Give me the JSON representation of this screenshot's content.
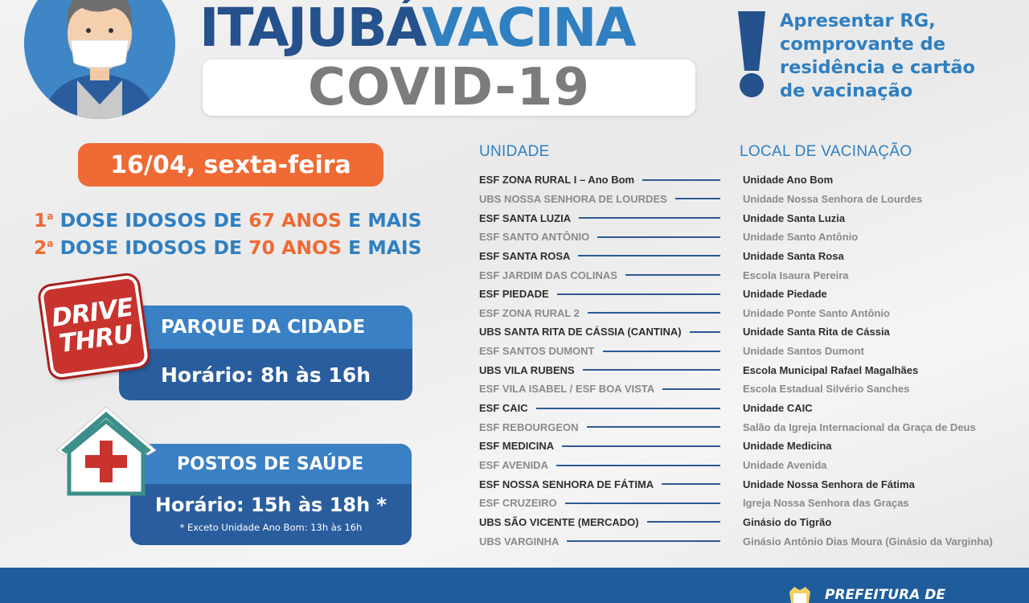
{
  "header": {
    "title_part1": "ITAJUBÁ",
    "title_part2": "VACINA",
    "subtitle": "COVID-19",
    "notice": "Apresentar RG,\ncomprovante de\nresidência e cartão\nde vacinação"
  },
  "schedule": {
    "date": "16/04, sexta-feira",
    "dose1": {
      "ord": "1",
      "sup": "a",
      "pre": "DOSE IDOSOS DE ",
      "age": "67 ANOS",
      "post": " E MAIS"
    },
    "dose2": {
      "ord": "2",
      "sup": "a",
      "pre": "DOSE IDOSOS DE ",
      "age": "70 ANOS",
      "post": " E MAIS"
    }
  },
  "drive_thru": {
    "sign_line1": "DRIVE",
    "sign_line2": "THRU",
    "location": "PARQUE DA CIDADE",
    "hours": "Horário: 8h às 16h"
  },
  "postos": {
    "location": "POSTOS DE SAÚDE",
    "hours": "Horário: 15h às 18h *",
    "note": "* Exceto Unidade Ano Bom: 13h às 16h"
  },
  "table": {
    "col_unit": "UNIDADE",
    "col_local": "LOCAL DE VACINAÇÃO",
    "rows": [
      {
        "unit": "ESF ZONA RURAL I – Ano Bom",
        "local": "Unidade Ano Bom"
      },
      {
        "unit": "UBS NOSSA SENHORA DE LOURDES",
        "local": "Unidade Nossa Senhora de Lourdes"
      },
      {
        "unit": "ESF SANTA LUZIA",
        "local": "Unidade Santa Luzia"
      },
      {
        "unit": "ESF SANTO ANTÔNIO",
        "local": "Unidade Santo Antônio"
      },
      {
        "unit": "ESF SANTA ROSA",
        "local": "Unidade Santa Rosa"
      },
      {
        "unit": "ESF JARDIM DAS COLINAS",
        "local": "Escola Isaura Pereira"
      },
      {
        "unit": "ESF PIEDADE",
        "local": "Unidade Piedade"
      },
      {
        "unit": "ESF ZONA RURAL 2",
        "local": "Unidade Ponte Santo Antônio"
      },
      {
        "unit": "UBS SANTA RITA DE CÁSSIA (CANTINA)",
        "local": "Unidade Santa Rita de Cássia"
      },
      {
        "unit": "ESF SANTOS DUMONT",
        "local": "Unidade Santos Dumont"
      },
      {
        "unit": "UBS VILA RUBENS",
        "local": "Escola Municipal Rafael Magalhães"
      },
      {
        "unit": "ESF VILA ISABEL / ESF BOA VISTA",
        "local": "Escola Estadual Silvério Sanches"
      },
      {
        "unit": "ESF CAIC",
        "local": "Unidade CAIC"
      },
      {
        "unit": "ESF REBOURGEON",
        "local": "Salão da Igreja Internacional da Graça de Deus"
      },
      {
        "unit": "ESF MEDICINA",
        "local": "Unidade Medicina"
      },
      {
        "unit": "ESF AVENIDA",
        "local": "Unidade Avenida"
      },
      {
        "unit": "ESF NOSSA SENHORA DE FÁTIMA",
        "local": "Unidade Nossa Senhora de Fátima"
      },
      {
        "unit": "ESF CRUZEIRO",
        "local": "Igreja Nossa Senhora das Graças"
      },
      {
        "unit": "UBS SÃO VICENTE (MERCADO)",
        "local": "Ginásio do Tigrão"
      },
      {
        "unit": "UBS VARGINHA",
        "local": "Ginásio Antônio Dias Moura (Ginásio da Varginha)"
      }
    ]
  },
  "footer": {
    "org": "PREFEITURA DE"
  },
  "colors": {
    "dark_blue": "#25518c",
    "blue": "#2f7fc1",
    "orange": "#ef6a34",
    "red": "#c8332e",
    "footer": "#1f5c9c"
  },
  "icons": [
    "masked-person-icon",
    "exclamation-icon",
    "drive-thru-sign-icon",
    "health-house-icon",
    "crest-icon"
  ]
}
